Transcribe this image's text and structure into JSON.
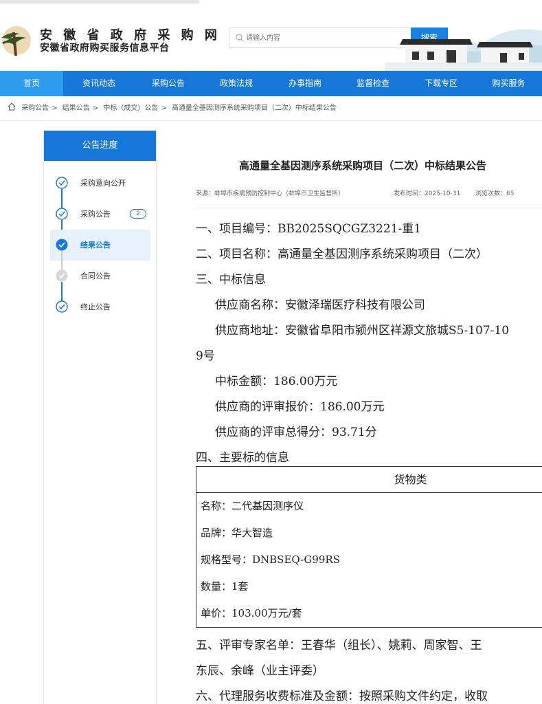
{
  "site": {
    "title": "安 徽 省 政 府 采 购 网",
    "subtitle": "安徽省政府购买服务信息平台"
  },
  "search": {
    "placeholder": "请输入内容",
    "button": "搜索"
  },
  "nav": [
    "首页",
    "资讯动态",
    "采购公告",
    "政策法规",
    "办事指南",
    "监督检查",
    "下载专区",
    "购买服务"
  ],
  "breadcrumb": [
    "采购公告",
    "结果公告",
    "中标（成交）公告",
    "高通量全基因测序系统采购项目（二次）中标结果公告"
  ],
  "sidebar": {
    "title": "公告进度",
    "steps": [
      {
        "label": "采购意向公开",
        "state": "done"
      },
      {
        "label": "采购公告",
        "state": "done",
        "badge": "2"
      },
      {
        "label": "结果公告",
        "state": "active"
      },
      {
        "label": "合同公告",
        "state": "pending"
      },
      {
        "label": "终止公告",
        "state": "done"
      }
    ]
  },
  "article": {
    "title": "高通量全基因测序系统采购项目（二次）中标结果公告",
    "source": "来源：蚌埠市疾病预防控制中心（蚌埠市卫生监督所）",
    "publish_time": "发布时间：2025-10-31",
    "views": "浏览次数：65",
    "p1": "一、项目编号：BB2025SQCGZ3221-重1",
    "p2": "二、项目名称：高通量全基因测序系统采购项目（二次）",
    "p3": "三、中标信息",
    "p4": "供应商名称：安徽泽瑞医疗科技有限公司",
    "p5a": "供应商地址：安徽省阜阳市颍州区祥源文旅城S5-107-10",
    "p5b": "9号",
    "p6": "中标金额：186.00万元",
    "p7": "供应商的评审报价：186.00万元",
    "p8": "供应商的评审总得分：93.71分",
    "p9": "四、主要标的信息",
    "table": {
      "header": "货物类",
      "rows": [
        "名称：二代基因测序仪",
        "品牌：华大智造",
        "规格型号：DNBSEQ-G99RS",
        "数量：1套",
        "单价：103.00万元/套"
      ]
    },
    "p10a": "五、评审专家名单：王春华（组长）、姚莉、周家智、王",
    "p10b": "东辰、余峰（业主评委）",
    "p11": "六、代理服务收费标准及金额：按照采购文件约定，收取"
  },
  "colors": {
    "primary": "#1677d9",
    "nav_active": "#2d9cf0"
  }
}
